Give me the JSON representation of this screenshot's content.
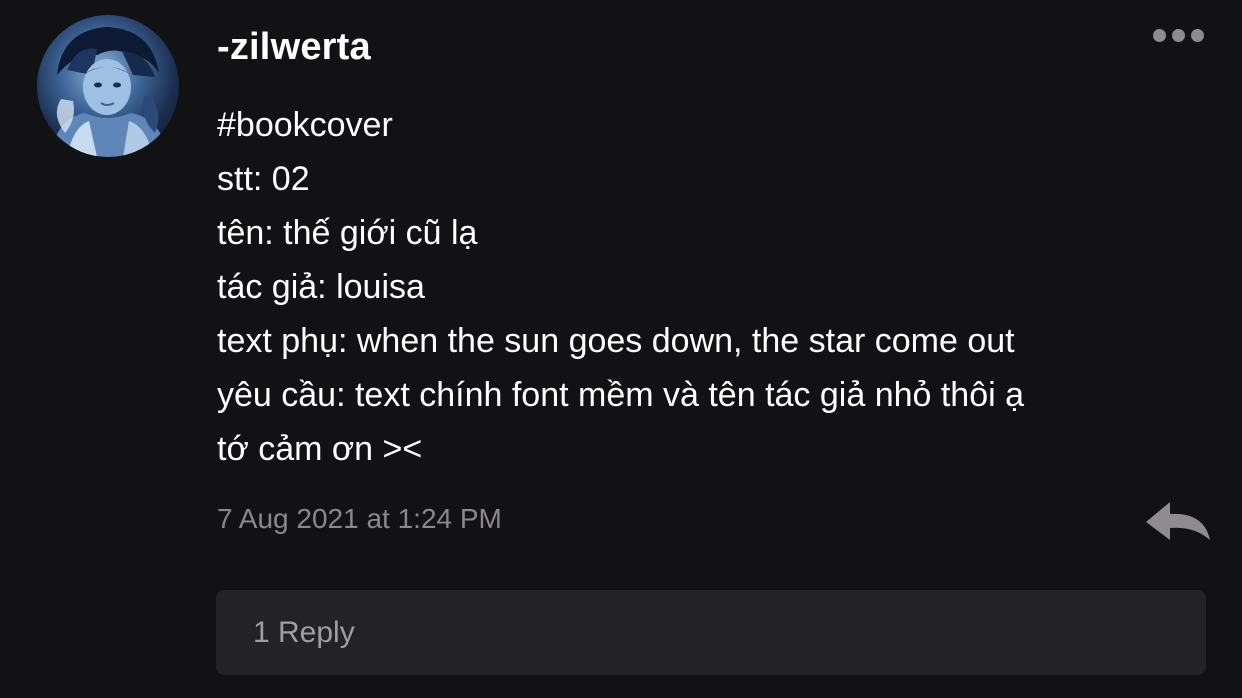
{
  "comment": {
    "username": "-zilwerta",
    "avatar_icon": "user-avatar-photo",
    "more_icon": "more-options-icon",
    "lines": [
      "#bookcover",
      "stt: 02",
      "tên: thế giới cũ lạ",
      "tác giả: louisa",
      "text phụ: when the sun goes down, the star come out",
      "yêu cầu: text chính font mềm và tên tác giả nhỏ thôi ạ",
      "tớ cảm ơn ><"
    ],
    "timestamp": "7 Aug 2021 at 1:24 PM",
    "reply_icon": "reply-arrow-icon",
    "replies_label": "1 Reply"
  },
  "colors": {
    "background": "#121113",
    "text": "#ffffff",
    "muted_text": "#8a888d",
    "replies_bar": "#232224",
    "icon_gray": "#8e8c90"
  }
}
